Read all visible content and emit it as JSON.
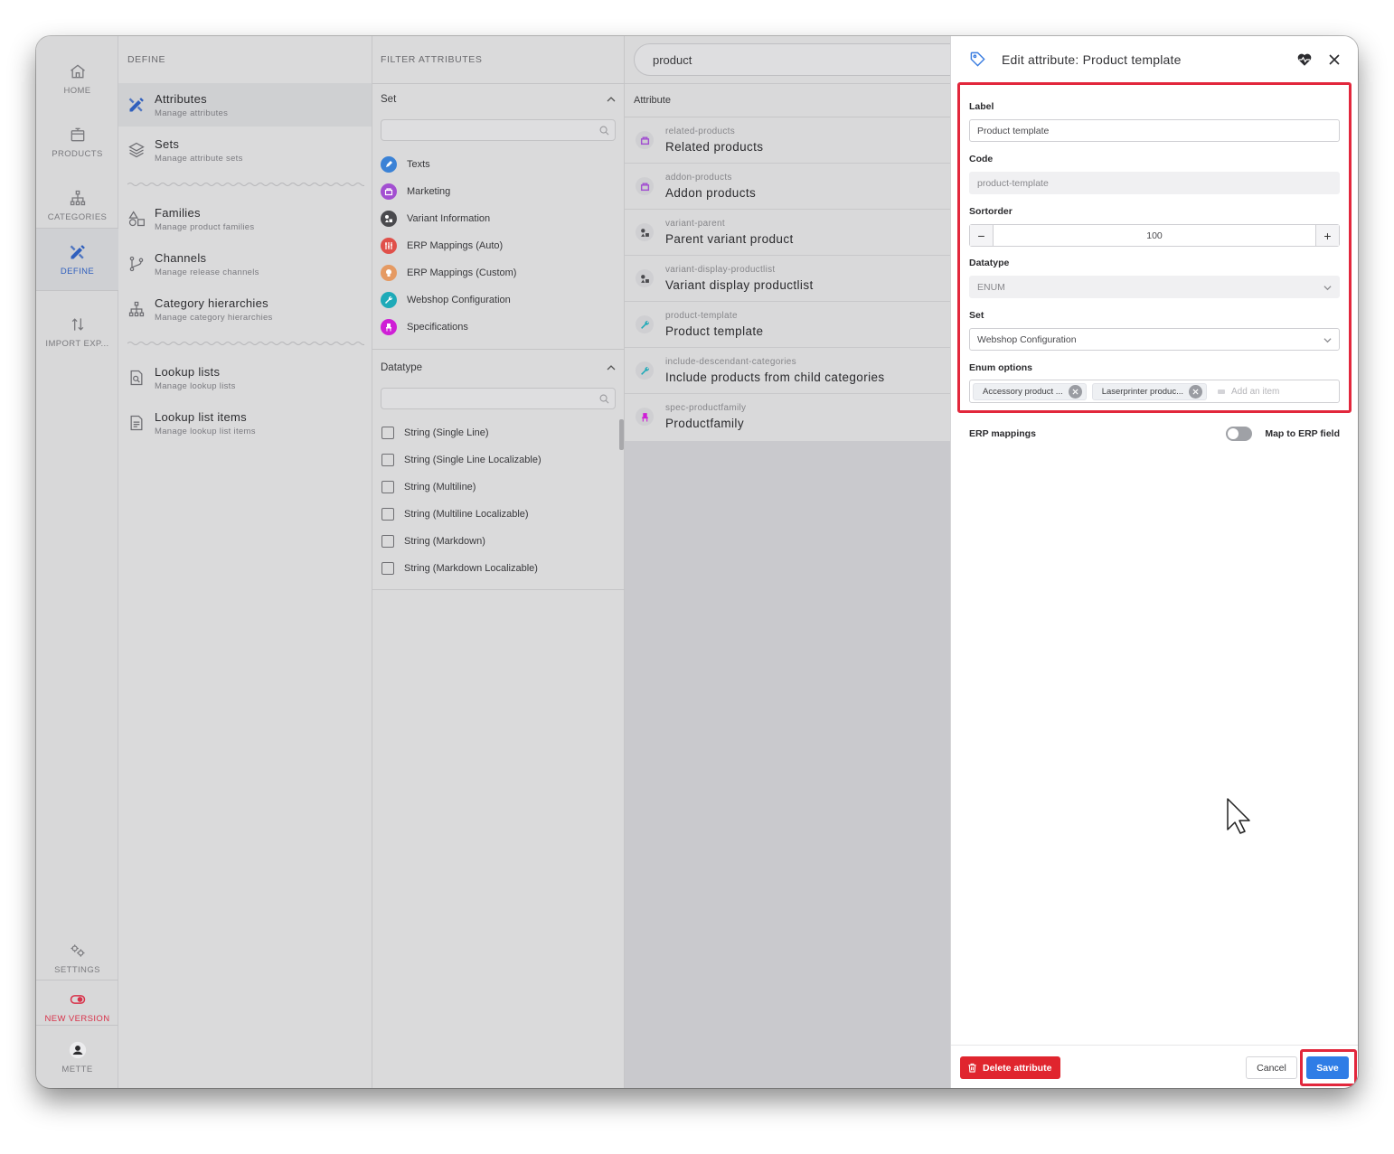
{
  "rail": {
    "home": "HOME",
    "products": "PRODUCTS",
    "categories": "CATEGORIES",
    "define": "DEFINE",
    "import_export": "IMPORT EXP...",
    "settings": "SETTINGS",
    "new_version": "NEW VERSION",
    "user": "METTE"
  },
  "define": {
    "heading": "DEFINE",
    "items": [
      {
        "title": "Attributes",
        "sub": "Manage attributes"
      },
      {
        "title": "Sets",
        "sub": "Manage attribute sets"
      },
      {
        "title": "Families",
        "sub": "Manage product families"
      },
      {
        "title": "Channels",
        "sub": "Manage release channels"
      },
      {
        "title": "Category hierarchies",
        "sub": "Manage category hierarchies"
      },
      {
        "title": "Lookup lists",
        "sub": "Manage lookup lists"
      },
      {
        "title": "Lookup list items",
        "sub": "Manage lookup list items"
      }
    ]
  },
  "filter": {
    "heading": "FILTER ATTRIBUTES",
    "set_label": "Set",
    "sets": [
      {
        "label": "Texts",
        "color": "#3b82d6"
      },
      {
        "label": "Marketing",
        "color": "#a24fd1"
      },
      {
        "label": "Variant Information",
        "color": "#4a4a4e"
      },
      {
        "label": "ERP Mappings (Auto)",
        "color": "#e0504a"
      },
      {
        "label": "ERP Mappings (Custom)",
        "color": "#e59a63"
      },
      {
        "label": "Webshop Configuration",
        "color": "#1eaab8"
      },
      {
        "label": "Specifications",
        "color": "#cf1fd6"
      }
    ],
    "datatype_label": "Datatype",
    "datatypes": [
      "String (Single Line)",
      "String (Single Line Localizable)",
      "String (Multiline)",
      "String (Multiline Localizable)",
      "String (Markdown)",
      "String (Markdown Localizable)"
    ]
  },
  "list": {
    "search_value": "product",
    "column_header": "Attribute",
    "rows": [
      {
        "code": "related-products",
        "name": "Related products"
      },
      {
        "code": "addon-products",
        "name": "Addon products"
      },
      {
        "code": "variant-parent",
        "name": "Parent variant product"
      },
      {
        "code": "variant-display-productlist",
        "name": "Variant display productlist"
      },
      {
        "code": "product-template",
        "name": "Product template"
      },
      {
        "code": "include-descendant-categories",
        "name": "Include products from child categories"
      },
      {
        "code": "spec-productfamily",
        "name": "Productfamily"
      }
    ]
  },
  "edit": {
    "title": "Edit attribute: Product template",
    "label_label": "Label",
    "label_value": "Product template",
    "code_label": "Code",
    "code_value": "product-template",
    "sortorder_label": "Sortorder",
    "sortorder_value": "100",
    "minus": "−",
    "plus": "+",
    "datatype_label": "Datatype",
    "datatype_value": "ENUM",
    "set_label": "Set",
    "set_value": "Webshop Configuration",
    "enum_label": "Enum options",
    "enum_options": [
      "Accessory product ...",
      "Laserprinter produc..."
    ],
    "enum_placeholder": "Add an item",
    "erp_label": "ERP mappings",
    "erp_toggle_label": "Map to ERP field",
    "delete_label": "Delete attribute",
    "cancel_label": "Cancel",
    "save_label": "Save"
  }
}
